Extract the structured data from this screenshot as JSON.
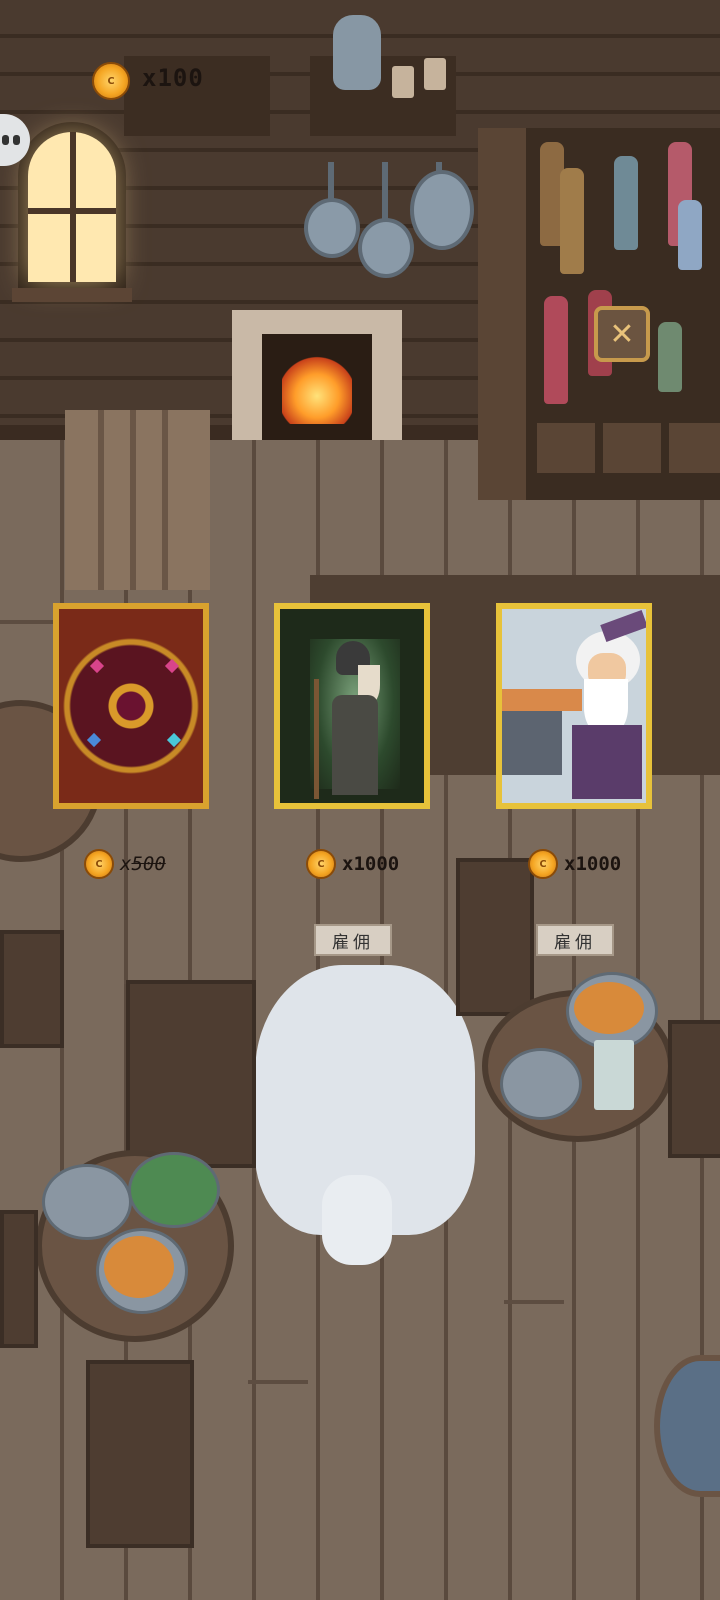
{
  "hud": {
    "coin_count": "x100",
    "menu_icon": "pause-dots-icon",
    "close_icon": "close-x-icon"
  },
  "shop": {
    "cards": [
      {
        "name": "card-back",
        "price_prefix": "x",
        "price": "500",
        "price_style": "strikethrough-italic"
      },
      {
        "name": "plague-doctor",
        "price": "x1000",
        "button_label": "雇佣"
      },
      {
        "name": "white-bearded-blacksmith",
        "price": "x1000",
        "button_label": "雇佣"
      }
    ]
  },
  "colors": {
    "coin": "#f5a623",
    "card_border": "#e7c23a",
    "floor": "#7a6a5c",
    "button_bg": "#d8cfc3"
  }
}
